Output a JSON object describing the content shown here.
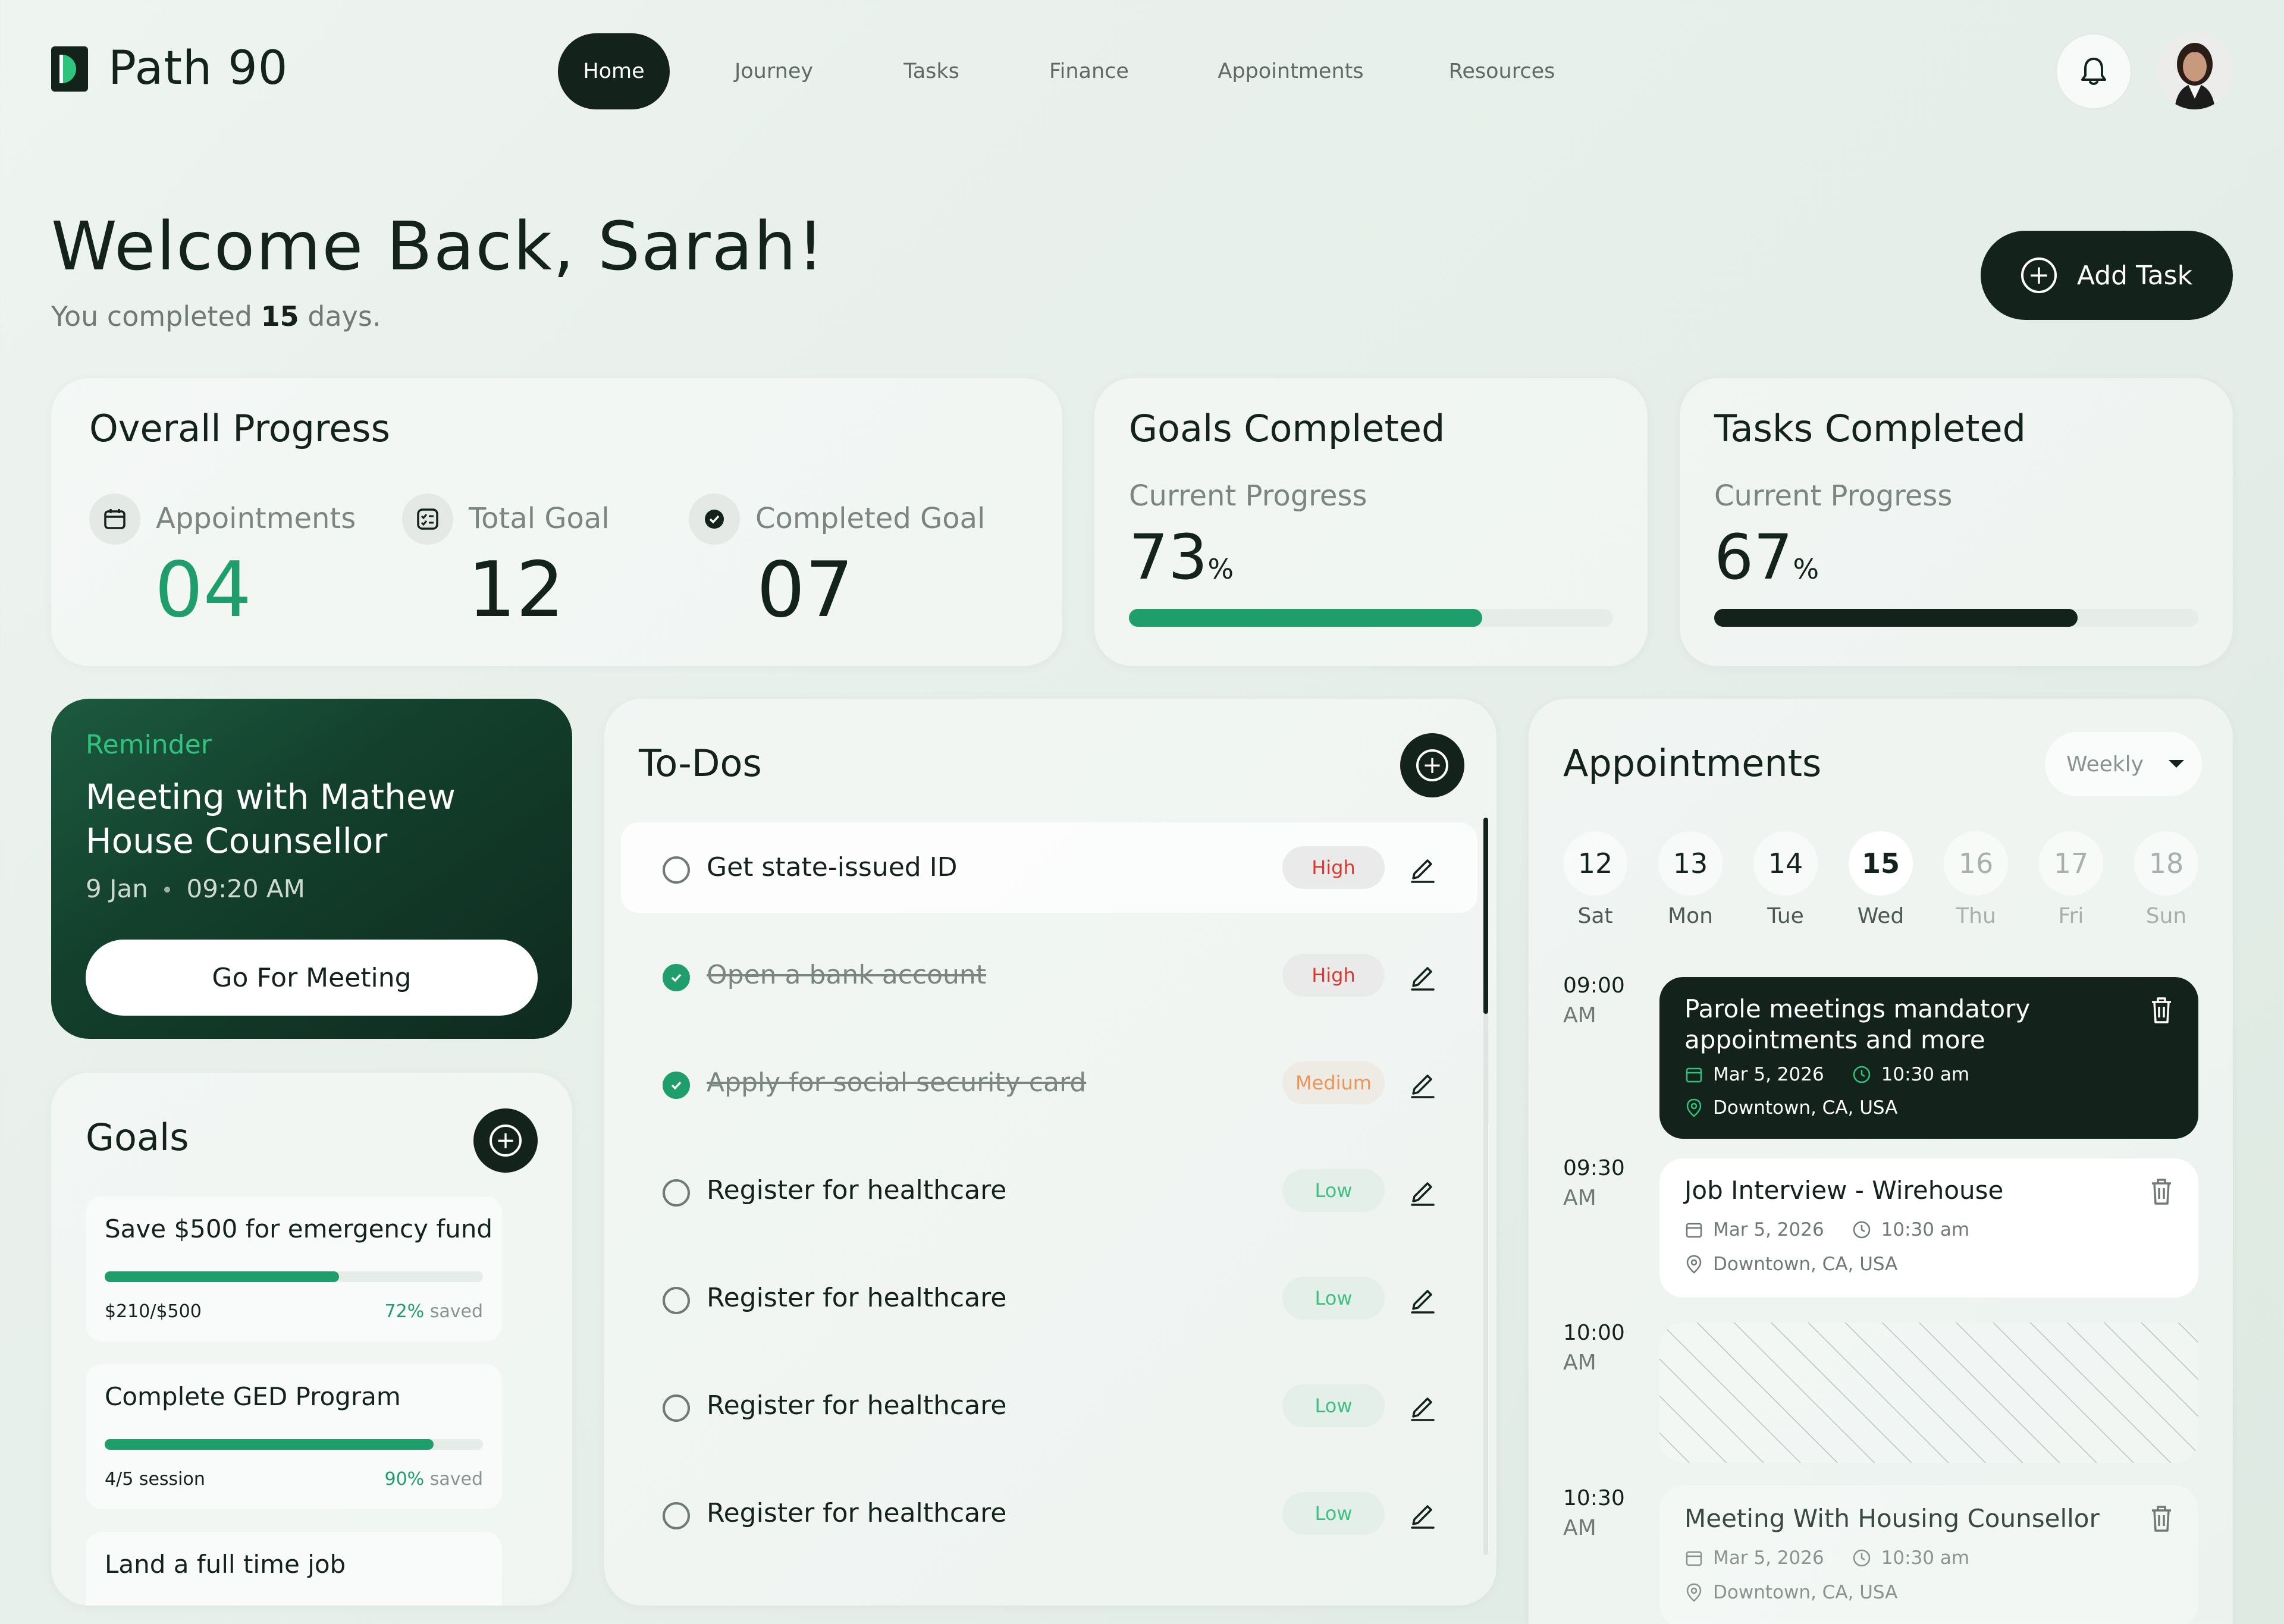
{
  "brand": {
    "name": "Path 90"
  },
  "nav": [
    {
      "label": "Home",
      "active": true
    },
    {
      "label": "Journey"
    },
    {
      "label": "Tasks"
    },
    {
      "label": "Finance"
    },
    {
      "label": "Appointments"
    },
    {
      "label": "Resources"
    }
  ],
  "welcome": {
    "title": "Welcome Back, Sarah!",
    "sub_prefix": "You completed",
    "sub_days": "15",
    "sub_suffix": "days."
  },
  "add_task": {
    "label": "Add Task"
  },
  "overall_progress": {
    "title": "Overall Progress",
    "stats": [
      {
        "label": "Appointments",
        "value": "04",
        "icon": "calendar-icon"
      },
      {
        "label": "Total Goal",
        "value": "12",
        "icon": "checklist-icon"
      },
      {
        "label": "Completed Goal",
        "value": "07",
        "icon": "check-circle-icon"
      }
    ]
  },
  "goals_completed": {
    "title": "Goals Completed",
    "label": "Current Progress",
    "value": "73",
    "unit": "%",
    "progress": 0.73,
    "color": "#1f9d6a"
  },
  "tasks_completed": {
    "title": "Tasks Completed",
    "label": "Current Progress",
    "value": "67",
    "unit": "%",
    "progress": 0.75,
    "color": "#13231c"
  },
  "reminder": {
    "label": "Reminder",
    "title": "Meeting with Mathew House Counsellor",
    "date": "9 Jan",
    "time": "09:20 AM",
    "button": "Go For Meeting"
  },
  "goals": {
    "title": "Goals",
    "items": [
      {
        "title": "Save $500 for emergency fund",
        "left": "$210/$500",
        "pct": "72%",
        "suffix": "saved",
        "progress": 0.62
      },
      {
        "title": "Complete GED Program",
        "left": "4/5 session",
        "pct": "90%",
        "suffix": "saved",
        "progress": 0.87
      },
      {
        "title": "Land a full time job"
      }
    ]
  },
  "todos": {
    "title": "To-Dos",
    "items": [
      {
        "text": "Get state-issued ID",
        "priority": "High",
        "done": false
      },
      {
        "text": "Open a bank account",
        "priority": "High",
        "done": true
      },
      {
        "text": "Apply for social security card",
        "priority": "Medium",
        "done": true
      },
      {
        "text": "Register for healthcare",
        "priority": "Low",
        "done": false
      },
      {
        "text": "Register for healthcare",
        "priority": "Low",
        "done": false
      },
      {
        "text": "Register for healthcare",
        "priority": "Low",
        "done": false
      },
      {
        "text": "Register for healthcare",
        "priority": "Low",
        "done": false
      }
    ]
  },
  "appointments": {
    "title": "Appointments",
    "view": "Weekly",
    "days": [
      {
        "num": "12",
        "name": "Sat"
      },
      {
        "num": "13",
        "name": "Mon"
      },
      {
        "num": "14",
        "name": "Tue"
      },
      {
        "num": "15",
        "name": "Wed",
        "active": true
      },
      {
        "num": "16",
        "name": "Thu",
        "faded": true
      },
      {
        "num": "17",
        "name": "Fri",
        "faded": true
      },
      {
        "num": "18",
        "name": "Sun",
        "faded": true
      }
    ],
    "times": [
      {
        "t": "09:00",
        "p": "AM"
      },
      {
        "t": "09:30",
        "p": "AM"
      },
      {
        "t": "10:00",
        "p": "AM"
      },
      {
        "t": "10:30",
        "p": "AM"
      }
    ],
    "events": [
      {
        "title": "Parole meetings mandatory appointments and more",
        "date": "Mar 5, 2026",
        "time": "10:30 am",
        "place": "Downtown, CA, USA"
      },
      {
        "title": "Job Interview - Wirehouse",
        "date": "Mar 5, 2026",
        "time": "10:30 am",
        "place": "Downtown, CA, USA"
      },
      {
        "title": "Meeting With Housing Counsellor",
        "date": "Mar 5, 2026",
        "time": "10:30 am",
        "place": "Downtown, CA, USA"
      }
    ]
  }
}
